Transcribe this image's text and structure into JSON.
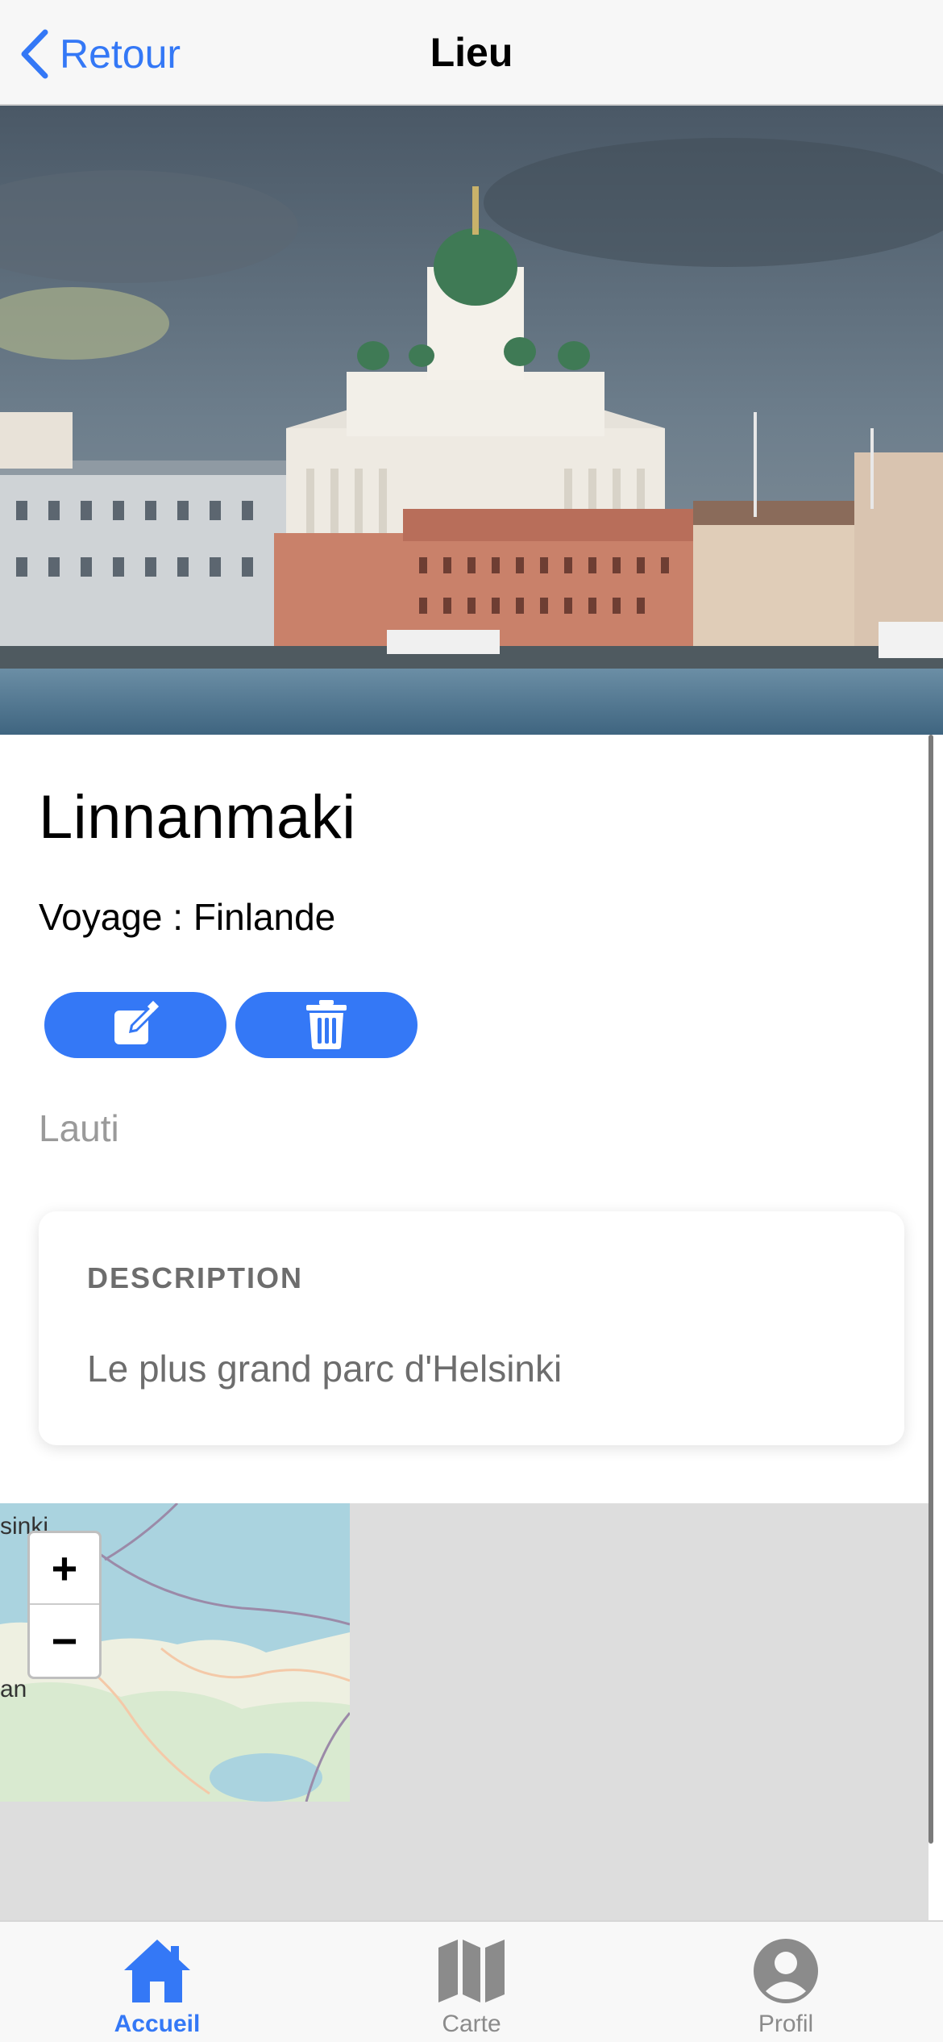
{
  "header": {
    "back_label": "Retour",
    "title": "Lieu"
  },
  "place": {
    "name": "Linnanmaki",
    "trip_line": "Voyage : Finlande",
    "author": "Lauti"
  },
  "description": {
    "heading": "DESCRIPTION",
    "text": "Le plus grand parc d'Helsinki"
  },
  "map": {
    "zoom_in": "+",
    "zoom_out": "−",
    "visible_label_top": "sinki",
    "visible_label_left": "an"
  },
  "tabs": [
    {
      "label": "Accueil",
      "icon": "home-icon",
      "active": true
    },
    {
      "label": "Carte",
      "icon": "map-icon",
      "active": false
    },
    {
      "label": "Profil",
      "icon": "user-circle-icon",
      "active": false
    }
  ],
  "colors": {
    "accent": "#3478f6",
    "muted_text": "#6d6d6d",
    "inactive_tab": "#8b8b8b"
  }
}
